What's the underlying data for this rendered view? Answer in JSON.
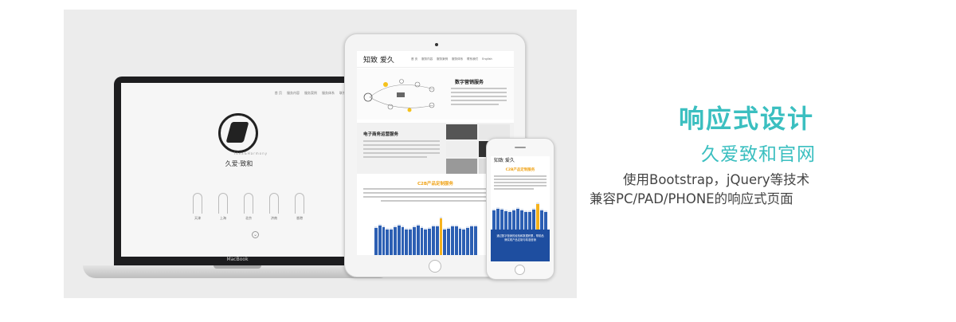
{
  "laptop": {
    "brand": "MacBook",
    "nav": [
      "首 页",
      "服务内容",
      "服务案例",
      "服务体系",
      "联系我们"
    ],
    "logo_sub": "Idea&Harmony",
    "logo_title": "久爱·致和",
    "cities": [
      "天津",
      "上海",
      "北京",
      "济南",
      "香港"
    ],
    "scroll_icon": "⌄"
  },
  "tablet": {
    "logo": "知致 爱久",
    "nav": [
      "首 页",
      "服务内容",
      "服务案例",
      "服务体系",
      "联系我们",
      "English"
    ],
    "section1_title": "数字营销服务",
    "section2_title": "电子商务运营服务",
    "section3_title": "C2B产品定制服务"
  },
  "phone": {
    "logo": "知致 爱久",
    "section_title": "C2B产品定制服务",
    "blue_text": "通过数字营销的经验和数据积累，帮助品牌实现产品定制与精准营销"
  },
  "headline": {
    "title": "响应式设计",
    "subtitle": "久爱致和官网",
    "line1": "使用Bootstrap，jQuery等技术",
    "line2": "兼容PC/PAD/PHONE的响应式页面"
  },
  "colors": {
    "accent": "#3bbfc0",
    "bar_blue": "#2c5fb3",
    "bar_highlight": "#f5b21c",
    "section_orange": "#f0a41a"
  }
}
